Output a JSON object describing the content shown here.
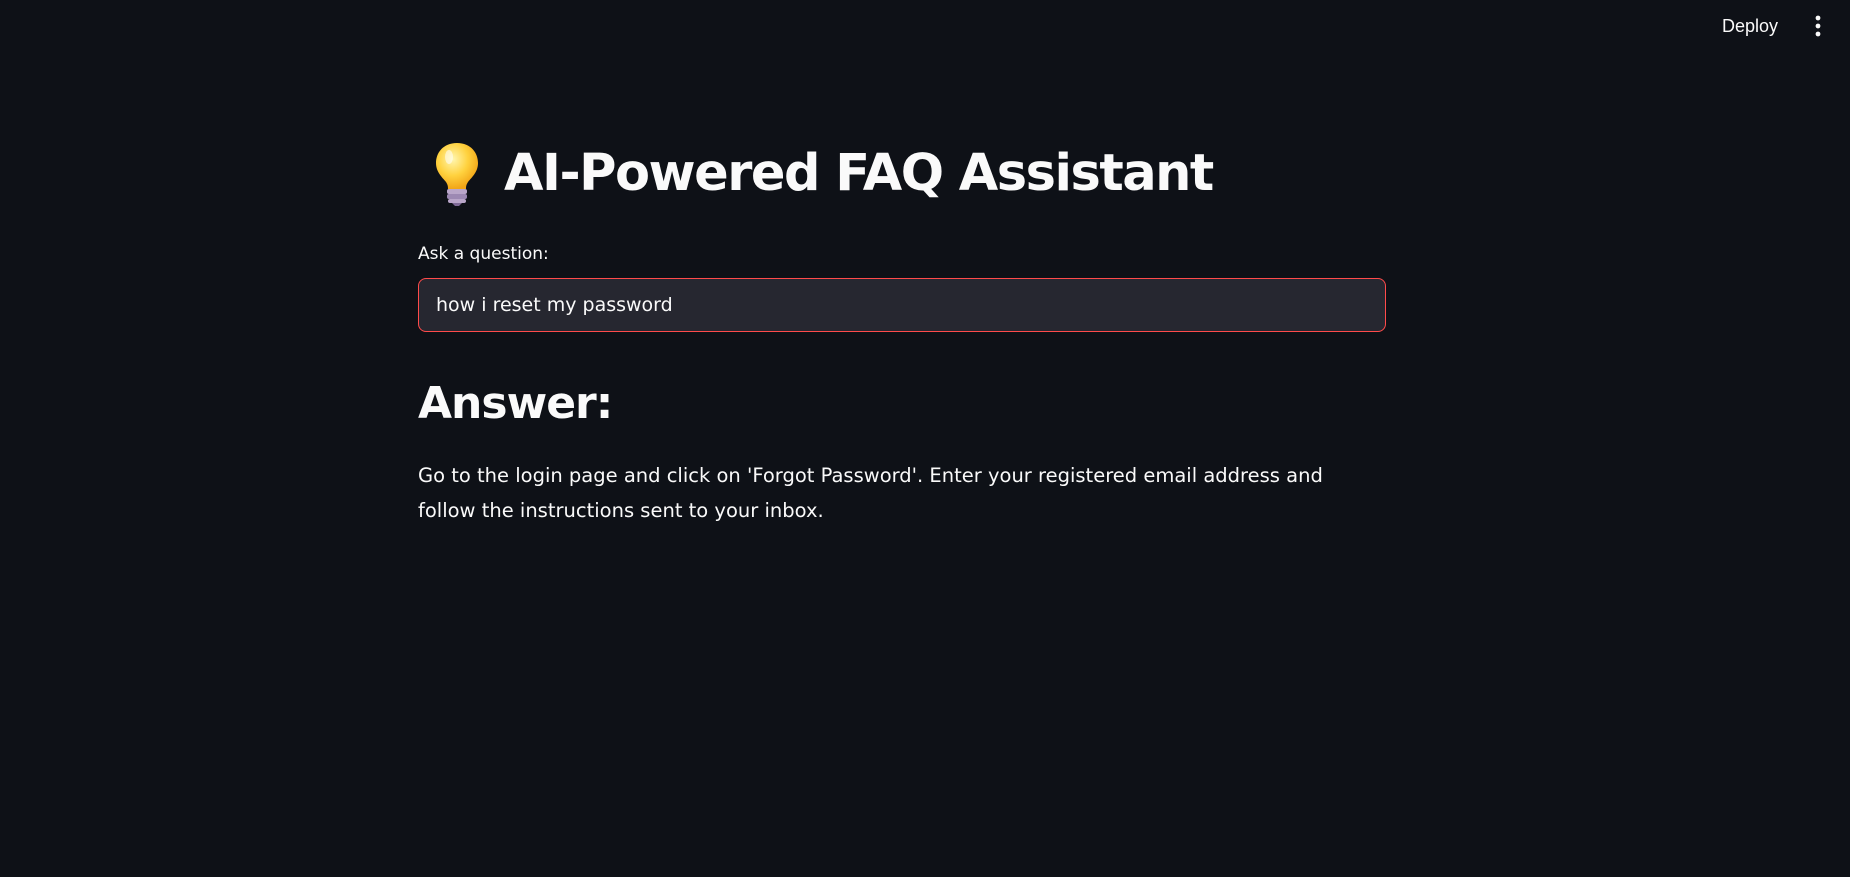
{
  "toolbar": {
    "deploy_label": "Deploy",
    "menu_icon": "kebab-menu-icon"
  },
  "header": {
    "title_icon": "lightbulb-icon",
    "title": "AI-Powered FAQ Assistant"
  },
  "form": {
    "question_label": "Ask a question:",
    "question_value": "how i reset my password"
  },
  "answer": {
    "heading": "Answer:",
    "text": "Go to the login page and click on 'Forgot Password'. Enter your registered email address and follow the instructions sent to your inbox."
  },
  "colors": {
    "background": "#0e1117",
    "input_background": "#262730",
    "input_focus_border": "#ff4b4b",
    "text": "#fafafa"
  }
}
